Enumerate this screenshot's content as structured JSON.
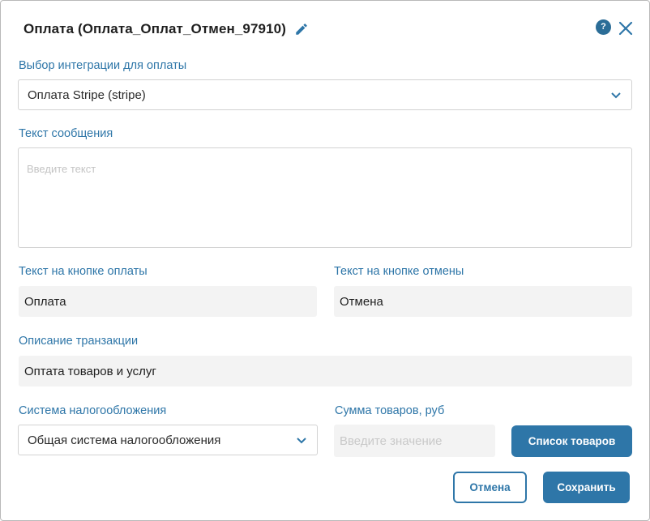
{
  "dialog": {
    "title": "Оплата (Оплата_Оплат_Отмен_97910)",
    "help_label": "?"
  },
  "integration": {
    "label": "Выбор интеграции для оплаты",
    "value": "Оплата Stripe (stripe)"
  },
  "message": {
    "label": "Текст сообщения",
    "placeholder": "Введите текст"
  },
  "pay_button_text": {
    "label": "Текст на кнопке оплаты",
    "value": "Оплата"
  },
  "cancel_button_text": {
    "label": "Текст на кнопке отмены",
    "value": "Отмена"
  },
  "transaction": {
    "label": "Описание транзакции",
    "value": "Оптата товаров и услуг"
  },
  "tax_system": {
    "label": "Система налогообложения",
    "value": "Общая система налогообложения"
  },
  "goods_sum": {
    "label": "Сумма товаров, руб",
    "placeholder": "Введите значение"
  },
  "buttons": {
    "goods_list": "Список товаров",
    "cancel": "Отмена",
    "save": "Сохранить"
  },
  "icons": {
    "edit": "pencil-icon",
    "help": "help-icon",
    "close": "close-icon",
    "dropdown": "chevron-down-icon"
  },
  "colors": {
    "accent": "#2e76a8",
    "label": "#2e76a8",
    "field_bg": "#f3f3f3"
  }
}
